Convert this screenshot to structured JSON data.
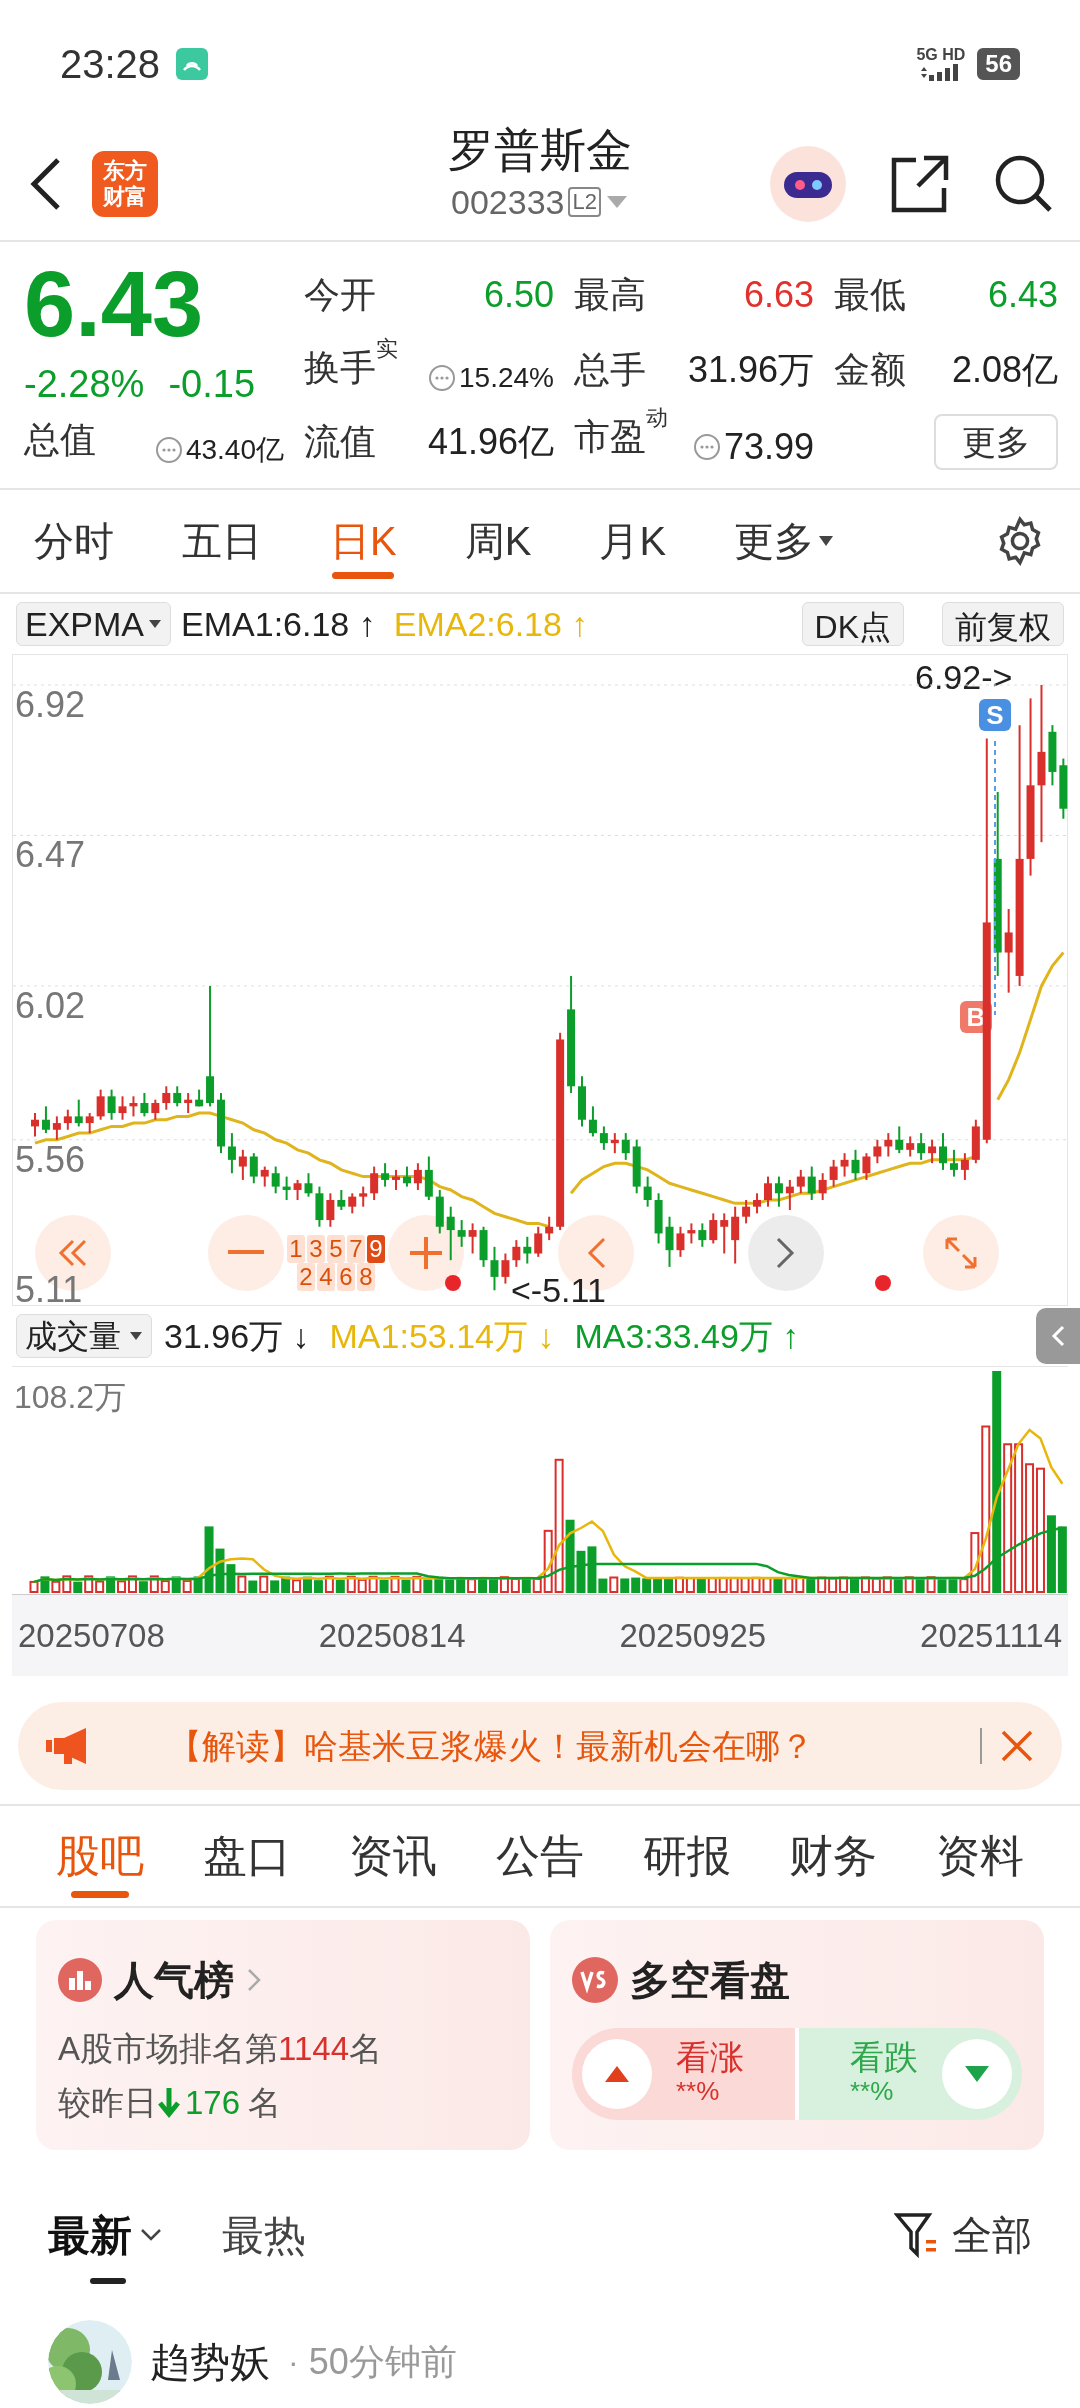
{
  "status_bar": {
    "time": "23:28",
    "network": "5G HD",
    "battery": "56"
  },
  "header": {
    "logo_lines": [
      "东方",
      "财富"
    ],
    "title": "罗普斯金",
    "code": "002333",
    "level_badge": "L2"
  },
  "quote": {
    "price": "6.43",
    "change_pct": "-2.28%",
    "change": "-0.15",
    "color": "#0c9e2a",
    "stats": [
      {
        "label": "今开",
        "value": "6.50",
        "color": "#0c9e2a"
      },
      {
        "label": "最高",
        "value": "6.63",
        "color": "#e0312c"
      },
      {
        "label": "最低",
        "value": "6.43",
        "color": "#0c9e2a"
      },
      {
        "label": "换手",
        "sup": "实",
        "info": true,
        "value": "15.24%",
        "color": "#222222"
      },
      {
        "label": "总手",
        "value": "31.96万",
        "color": "#222222"
      },
      {
        "label": "金额",
        "value": "2.08亿",
        "color": "#222222"
      },
      {
        "label": "总值",
        "info": true,
        "value": "43.40亿",
        "color": "#222222"
      },
      {
        "label": "流值",
        "value": "41.96亿",
        "color": "#222222"
      },
      {
        "label": "市盈",
        "sup": "动",
        "info": true,
        "value": "73.99",
        "color": "#222222"
      }
    ],
    "more_button": "更多"
  },
  "period_tabs": [
    {
      "label": "分时",
      "selected": false
    },
    {
      "label": "五日",
      "selected": false
    },
    {
      "label": "日K",
      "selected": true
    },
    {
      "label": "周K",
      "selected": false
    },
    {
      "label": "月K",
      "selected": false
    },
    {
      "label": "更多",
      "selected": false,
      "dropdown": true
    }
  ],
  "indicator": {
    "selector": "EXPMA",
    "ema1": "EMA1:6.18 ↑",
    "ema2": "EMA2:6.18 ↑",
    "dk": "DK点",
    "adjust": "前复权"
  },
  "price_chart": {
    "chart_data": {
      "type": "candlestick",
      "grid": true,
      "yticks": [
        6.92,
        6.47,
        6.02,
        5.56,
        5.11
      ],
      "ylim": [
        5.06,
        6.92
      ],
      "ohlc": [
        [
          5.6,
          5.64,
          5.57,
          5.62
        ],
        [
          5.62,
          5.66,
          5.58,
          5.59
        ],
        [
          5.59,
          5.63,
          5.56,
          5.61
        ],
        [
          5.61,
          5.65,
          5.59,
          5.63
        ],
        [
          5.63,
          5.68,
          5.6,
          5.61
        ],
        [
          5.61,
          5.64,
          5.58,
          5.63
        ],
        [
          5.63,
          5.71,
          5.62,
          5.69
        ],
        [
          5.69,
          5.71,
          5.62,
          5.64
        ],
        [
          5.64,
          5.69,
          5.62,
          5.66
        ],
        [
          5.66,
          5.69,
          5.63,
          5.67
        ],
        [
          5.67,
          5.7,
          5.63,
          5.64
        ],
        [
          5.64,
          5.68,
          5.62,
          5.67
        ],
        [
          5.67,
          5.72,
          5.65,
          5.7
        ],
        [
          5.7,
          5.72,
          5.66,
          5.67
        ],
        [
          5.67,
          5.7,
          5.64,
          5.68
        ],
        [
          5.68,
          5.71,
          5.66,
          5.66
        ],
        [
          5.75,
          6.02,
          5.66,
          5.67
        ],
        [
          5.68,
          5.7,
          5.52,
          5.54
        ],
        [
          5.54,
          5.58,
          5.46,
          5.5
        ],
        [
          5.48,
          5.53,
          5.44,
          5.51
        ],
        [
          5.51,
          5.52,
          5.43,
          5.45
        ],
        [
          5.45,
          5.48,
          5.42,
          5.47
        ],
        [
          5.46,
          5.48,
          5.4,
          5.42
        ],
        [
          5.42,
          5.45,
          5.38,
          5.41
        ],
        [
          5.41,
          5.44,
          5.38,
          5.43
        ],
        [
          5.43,
          5.46,
          5.39,
          5.4
        ],
        [
          5.4,
          5.42,
          5.3,
          5.32
        ],
        [
          5.32,
          5.4,
          5.3,
          5.38
        ],
        [
          5.38,
          5.41,
          5.35,
          5.36
        ],
        [
          5.36,
          5.4,
          5.34,
          5.39
        ],
        [
          5.39,
          5.42,
          5.36,
          5.4
        ],
        [
          5.4,
          5.48,
          5.38,
          5.46
        ],
        [
          5.46,
          5.49,
          5.42,
          5.44
        ],
        [
          5.44,
          5.47,
          5.41,
          5.45
        ],
        [
          5.45,
          5.48,
          5.42,
          5.43
        ],
        [
          5.43,
          5.49,
          5.41,
          5.47
        ],
        [
          5.47,
          5.51,
          5.38,
          5.39
        ],
        [
          5.39,
          5.41,
          5.28,
          5.3
        ],
        [
          5.33,
          5.36,
          5.2,
          5.29
        ],
        [
          5.29,
          5.32,
          5.24,
          5.27
        ],
        [
          5.27,
          5.31,
          5.22,
          5.29
        ],
        [
          5.29,
          5.3,
          5.18,
          5.2
        ],
        [
          5.2,
          5.24,
          5.11,
          5.15
        ],
        [
          5.15,
          5.22,
          5.13,
          5.2
        ],
        [
          5.2,
          5.26,
          5.18,
          5.24
        ],
        [
          5.24,
          5.27,
          5.19,
          5.22
        ],
        [
          5.22,
          5.3,
          5.21,
          5.28
        ],
        [
          5.28,
          5.33,
          5.26,
          5.3
        ],
        [
          5.3,
          5.88,
          5.29,
          5.86
        ],
        [
          5.95,
          6.05,
          5.7,
          5.72
        ],
        [
          5.72,
          5.75,
          5.6,
          5.62
        ],
        [
          5.62,
          5.66,
          5.57,
          5.58
        ],
        [
          5.58,
          5.6,
          5.53,
          5.55
        ],
        [
          5.55,
          5.58,
          5.52,
          5.56
        ],
        [
          5.56,
          5.58,
          5.5,
          5.52
        ],
        [
          5.54,
          5.56,
          5.4,
          5.42
        ],
        [
          5.42,
          5.45,
          5.36,
          5.38
        ],
        [
          5.38,
          5.4,
          5.25,
          5.28
        ],
        [
          5.3,
          5.33,
          5.18,
          5.23
        ],
        [
          5.23,
          5.3,
          5.21,
          5.28
        ],
        [
          5.28,
          5.31,
          5.25,
          5.29
        ],
        [
          5.29,
          5.31,
          5.24,
          5.26
        ],
        [
          5.26,
          5.34,
          5.25,
          5.32
        ],
        [
          5.3,
          5.34,
          5.22,
          5.32
        ],
        [
          5.26,
          5.36,
          5.19,
          5.33
        ],
        [
          5.33,
          5.38,
          5.31,
          5.36
        ],
        [
          5.36,
          5.4,
          5.34,
          5.38
        ],
        [
          5.38,
          5.45,
          5.36,
          5.43
        ],
        [
          5.43,
          5.45,
          5.36,
          5.4
        ],
        [
          5.4,
          5.44,
          5.35,
          5.42
        ],
        [
          5.42,
          5.47,
          5.4,
          5.45
        ],
        [
          5.45,
          5.48,
          5.38,
          5.4
        ],
        [
          5.4,
          5.46,
          5.38,
          5.44
        ],
        [
          5.44,
          5.5,
          5.42,
          5.48
        ],
        [
          5.48,
          5.52,
          5.45,
          5.5
        ],
        [
          5.5,
          5.53,
          5.44,
          5.46
        ],
        [
          5.46,
          5.52,
          5.44,
          5.51
        ],
        [
          5.51,
          5.56,
          5.49,
          5.54
        ],
        [
          5.54,
          5.58,
          5.51,
          5.56
        ],
        [
          5.56,
          5.6,
          5.52,
          5.53
        ],
        [
          5.53,
          5.57,
          5.51,
          5.55
        ],
        [
          5.55,
          5.58,
          5.5,
          5.52
        ],
        [
          5.52,
          5.56,
          5.49,
          5.54
        ],
        [
          5.54,
          5.58,
          5.47,
          5.49
        ],
        [
          5.49,
          5.53,
          5.45,
          5.47
        ],
        [
          5.47,
          5.52,
          5.44,
          5.5
        ],
        [
          5.5,
          5.62,
          5.49,
          5.6
        ],
        [
          5.56,
          6.76,
          5.55,
          6.21
        ],
        [
          6.4,
          6.6,
          6.05,
          6.12
        ],
        [
          6.12,
          6.25,
          6.0,
          6.18
        ],
        [
          6.05,
          6.8,
          6.02,
          6.4
        ],
        [
          6.4,
          6.88,
          6.35,
          6.62
        ],
        [
          6.62,
          6.92,
          6.45,
          6.72
        ],
        [
          6.78,
          6.8,
          6.62,
          6.66
        ],
        [
          6.68,
          6.7,
          6.52,
          6.55
        ]
      ],
      "series": [
        {
          "type": "line",
          "color": "#e0b41c",
          "values": [
            5.55,
            5.56,
            5.56,
            5.57,
            5.58,
            5.58,
            5.59,
            5.6,
            5.6,
            5.61,
            5.61,
            5.62,
            5.62,
            5.63,
            5.63,
            5.64,
            5.64,
            5.63,
            5.62,
            5.61,
            5.59,
            5.58,
            5.56,
            5.55,
            5.53,
            5.52,
            5.5,
            5.49,
            5.47,
            5.46,
            5.45,
            5.45,
            5.45,
            5.45,
            5.45,
            5.45,
            5.44,
            5.42,
            5.41,
            5.39,
            5.38,
            5.36,
            5.34,
            5.33,
            5.32,
            5.31,
            5.31,
            5.3,
            null,
            5.4,
            5.44,
            5.46,
            5.48,
            5.49,
            5.49,
            5.48,
            5.47,
            5.45,
            5.43,
            5.42,
            5.41,
            5.4,
            5.39,
            5.38,
            5.37,
            5.37,
            5.37,
            5.38,
            5.38,
            5.39,
            5.4,
            5.4,
            5.41,
            5.42,
            5.43,
            5.44,
            5.45,
            5.46,
            5.47,
            5.48,
            5.49,
            5.49,
            5.5,
            5.5,
            5.5,
            5.5,
            5.51,
            null,
            5.68,
            5.74,
            5.82,
            5.92,
            6.02,
            6.08,
            6.12
          ]
        }
      ]
    },
    "high_label": "6.92->",
    "low_label": "<-5.11",
    "buy_mark": "B",
    "sell_mark": "S",
    "nine_markers": [
      {
        "label": "1",
        "highlighted": false
      },
      {
        "label": "2",
        "highlighted": false
      },
      {
        "label": "3",
        "highlighted": false
      },
      {
        "label": "4",
        "highlighted": false
      },
      {
        "label": "5",
        "highlighted": false
      },
      {
        "label": "6",
        "highlighted": false
      },
      {
        "label": "7",
        "highlighted": false
      },
      {
        "label": "8",
        "highlighted": false
      },
      {
        "label": "9",
        "highlighted": true
      }
    ]
  },
  "volume": {
    "selector": "成交量",
    "current": "31.96万 ↓",
    "ma1": "MA1:53.14万 ↓",
    "ma3": "MA3:33.49万 ↑",
    "max_label": "108.2万",
    "dates": [
      "20250708",
      "20250814",
      "20250925",
      "20251114"
    ]
  },
  "banner": {
    "text": "【解读】哈基米豆浆爆火！最新机会在哪？"
  },
  "section_tabs": [
    {
      "label": "股吧",
      "selected": true
    },
    {
      "label": "盘口",
      "selected": false
    },
    {
      "label": "资讯",
      "selected": false
    },
    {
      "label": "公告",
      "selected": false
    },
    {
      "label": "研报",
      "selected": false
    },
    {
      "label": "财务",
      "selected": false
    },
    {
      "label": "资料",
      "selected": false
    }
  ],
  "popularity_card": {
    "title": "人气榜",
    "rank_line": "A股市场排名第**1144**名",
    "change_prefix": "较昨日",
    "change_value": "176",
    "change_suffix": "名"
  },
  "vs_card": {
    "title": "多空看盘",
    "bull": {
      "label": "看涨",
      "value": "**%"
    },
    "bear": {
      "label": "看跌",
      "value": "**%"
    }
  },
  "feed_sort": {
    "tabs": [
      {
        "label": "最新",
        "selected": true,
        "dropdown": true
      },
      {
        "label": "最热",
        "selected": false
      }
    ],
    "filter": "全部"
  },
  "post": {
    "author": "趋势妖",
    "separator": "·",
    "time": "50分钟前"
  }
}
